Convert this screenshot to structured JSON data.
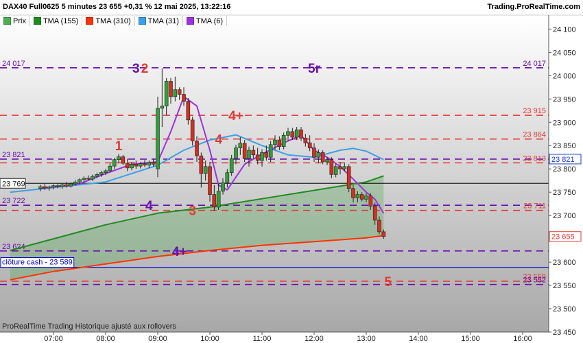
{
  "header": {
    "title": "DAX40 Full0625 5 minutes 23 655 +0,31 % 12 mai 2025, 13:22:16",
    "source": "Trading.ProRealTime.com",
    "footer": "ProRealTime Trading  Historique ajusté aux rollovers"
  },
  "legend": [
    {
      "label": "Prix",
      "color": "#4caf50"
    },
    {
      "label": "TMA (155)",
      "color": "#1e8c1e"
    },
    {
      "label": "TMA (310)",
      "color": "#ff3300"
    },
    {
      "label": "TMA (31)",
      "color": "#3da0e6"
    },
    {
      "label": "TMA (6)",
      "color": "#a030e0"
    }
  ],
  "chart_data": {
    "type": "candlestick",
    "instrument": "DAX40 Full0625",
    "timeframe": "5 minutes",
    "last_price": 23655,
    "change": "+0,31 %",
    "ylim": [
      23450,
      24130
    ],
    "y_ticks": [
      "24 100",
      "24 050",
      "24 000",
      "23 950",
      "23 900",
      "23 850",
      "23 800",
      "23 750",
      "23 700",
      "23 650",
      "23 600",
      "23 550",
      "23 500",
      "23 450"
    ],
    "x_ticks": [
      "07:00",
      "08:00",
      "09:00",
      "10:00",
      "11:00",
      "12:00",
      "13:00",
      "14:00",
      "15:00",
      "16:00"
    ],
    "x_ticks_time": [
      "07:00",
      "08:00",
      "09:00",
      "10:00",
      "11:00",
      "12:00",
      "13:00",
      "14:00",
      "15:00",
      "16:00"
    ],
    "candles": [
      {
        "t": "06:45",
        "o": 23758,
        "h": 23766,
        "l": 23752,
        "c": 23762
      },
      {
        "t": "06:50",
        "o": 23762,
        "h": 23768,
        "l": 23755,
        "c": 23759
      },
      {
        "t": "06:55",
        "o": 23759,
        "h": 23764,
        "l": 23753,
        "c": 23761
      },
      {
        "t": "07:00",
        "o": 23761,
        "h": 23767,
        "l": 23756,
        "c": 23764
      },
      {
        "t": "07:05",
        "o": 23764,
        "h": 23770,
        "l": 23758,
        "c": 23762
      },
      {
        "t": "07:10",
        "o": 23762,
        "h": 23769,
        "l": 23757,
        "c": 23766
      },
      {
        "t": "07:15",
        "o": 23766,
        "h": 23772,
        "l": 23760,
        "c": 23763
      },
      {
        "t": "07:20",
        "o": 23763,
        "h": 23771,
        "l": 23760,
        "c": 23768
      },
      {
        "t": "07:25",
        "o": 23768,
        "h": 23776,
        "l": 23764,
        "c": 23772
      },
      {
        "t": "07:30",
        "o": 23772,
        "h": 23780,
        "l": 23768,
        "c": 23777
      },
      {
        "t": "07:35",
        "o": 23777,
        "h": 23784,
        "l": 23772,
        "c": 23780
      },
      {
        "t": "07:40",
        "o": 23780,
        "h": 23786,
        "l": 23775,
        "c": 23778
      },
      {
        "t": "07:45",
        "o": 23778,
        "h": 23788,
        "l": 23774,
        "c": 23784
      },
      {
        "t": "07:50",
        "o": 23784,
        "h": 23792,
        "l": 23780,
        "c": 23788
      },
      {
        "t": "07:55",
        "o": 23788,
        "h": 23796,
        "l": 23783,
        "c": 23792
      },
      {
        "t": "08:00",
        "o": 23792,
        "h": 23800,
        "l": 23787,
        "c": 23796
      },
      {
        "t": "08:05",
        "o": 23796,
        "h": 23812,
        "l": 23792,
        "c": 23806
      },
      {
        "t": "08:10",
        "o": 23806,
        "h": 23824,
        "l": 23800,
        "c": 23820
      },
      {
        "t": "08:15",
        "o": 23820,
        "h": 23832,
        "l": 23812,
        "c": 23826
      },
      {
        "t": "08:20",
        "o": 23826,
        "h": 23830,
        "l": 23808,
        "c": 23812
      },
      {
        "t": "08:25",
        "o": 23812,
        "h": 23822,
        "l": 23795,
        "c": 23802
      },
      {
        "t": "08:30",
        "o": 23802,
        "h": 23815,
        "l": 23797,
        "c": 23810
      },
      {
        "t": "08:35",
        "o": 23810,
        "h": 23818,
        "l": 23800,
        "c": 23806
      },
      {
        "t": "08:40",
        "o": 23806,
        "h": 23814,
        "l": 23801,
        "c": 23811
      },
      {
        "t": "08:45",
        "o": 23811,
        "h": 23819,
        "l": 23804,
        "c": 23808
      },
      {
        "t": "08:50",
        "o": 23808,
        "h": 23818,
        "l": 23802,
        "c": 23814
      },
      {
        "t": "08:55",
        "o": 23814,
        "h": 23822,
        "l": 23805,
        "c": 23810
      },
      {
        "t": "09:00",
        "o": 23800,
        "h": 23955,
        "l": 23782,
        "c": 23930
      },
      {
        "t": "09:05",
        "o": 23930,
        "h": 24016,
        "l": 23890,
        "c": 23935
      },
      {
        "t": "09:10",
        "o": 23935,
        "h": 23995,
        "l": 23915,
        "c": 23988
      },
      {
        "t": "09:15",
        "o": 23988,
        "h": 23995,
        "l": 23940,
        "c": 23955
      },
      {
        "t": "09:20",
        "o": 23955,
        "h": 23998,
        "l": 23945,
        "c": 23970
      },
      {
        "t": "09:25",
        "o": 23970,
        "h": 23975,
        "l": 23948,
        "c": 23960
      },
      {
        "t": "09:30",
        "o": 23960,
        "h": 23975,
        "l": 23935,
        "c": 23945
      },
      {
        "t": "09:35",
        "o": 23945,
        "h": 23952,
        "l": 23895,
        "c": 23905
      },
      {
        "t": "09:40",
        "o": 23905,
        "h": 23912,
        "l": 23850,
        "c": 23860
      },
      {
        "t": "09:45",
        "o": 23860,
        "h": 23870,
        "l": 23815,
        "c": 23828
      },
      {
        "t": "09:50",
        "o": 23828,
        "h": 23835,
        "l": 23760,
        "c": 23790
      },
      {
        "t": "09:55",
        "o": 23790,
        "h": 23818,
        "l": 23775,
        "c": 23805
      },
      {
        "t": "10:00",
        "o": 23805,
        "h": 23815,
        "l": 23730,
        "c": 23745
      },
      {
        "t": "10:05",
        "o": 23745,
        "h": 23765,
        "l": 23710,
        "c": 23718
      },
      {
        "t": "10:10",
        "o": 23718,
        "h": 23768,
        "l": 23712,
        "c": 23752
      },
      {
        "t": "10:15",
        "o": 23752,
        "h": 23780,
        "l": 23745,
        "c": 23770
      },
      {
        "t": "10:20",
        "o": 23770,
        "h": 23800,
        "l": 23760,
        "c": 23792
      },
      {
        "t": "10:25",
        "o": 23792,
        "h": 23830,
        "l": 23785,
        "c": 23822
      },
      {
        "t": "10:30",
        "o": 23822,
        "h": 23852,
        "l": 23810,
        "c": 23845
      },
      {
        "t": "10:35",
        "o": 23845,
        "h": 23868,
        "l": 23830,
        "c": 23855
      },
      {
        "t": "10:40",
        "o": 23855,
        "h": 23862,
        "l": 23815,
        "c": 23822
      },
      {
        "t": "10:45",
        "o": 23822,
        "h": 23848,
        "l": 23805,
        "c": 23840
      },
      {
        "t": "10:50",
        "o": 23840,
        "h": 23850,
        "l": 23822,
        "c": 23830
      },
      {
        "t": "10:55",
        "o": 23830,
        "h": 23845,
        "l": 23810,
        "c": 23818
      },
      {
        "t": "11:00",
        "o": 23818,
        "h": 23842,
        "l": 23805,
        "c": 23835
      },
      {
        "t": "11:05",
        "o": 23835,
        "h": 23850,
        "l": 23818,
        "c": 23825
      },
      {
        "t": "11:10",
        "o": 23825,
        "h": 23860,
        "l": 23815,
        "c": 23852
      },
      {
        "t": "11:15",
        "o": 23852,
        "h": 23872,
        "l": 23840,
        "c": 23862
      },
      {
        "t": "11:20",
        "o": 23862,
        "h": 23870,
        "l": 23840,
        "c": 23848
      },
      {
        "t": "11:25",
        "o": 23848,
        "h": 23878,
        "l": 23842,
        "c": 23872
      },
      {
        "t": "11:30",
        "o": 23872,
        "h": 23888,
        "l": 23860,
        "c": 23880
      },
      {
        "t": "11:35",
        "o": 23880,
        "h": 23888,
        "l": 23862,
        "c": 23868
      },
      {
        "t": "11:40",
        "o": 23868,
        "h": 23890,
        "l": 23862,
        "c": 23884
      },
      {
        "t": "11:45",
        "o": 23884,
        "h": 23890,
        "l": 23860,
        "c": 23866
      },
      {
        "t": "11:50",
        "o": 23866,
        "h": 23875,
        "l": 23848,
        "c": 23856
      },
      {
        "t": "11:55",
        "o": 23856,
        "h": 23872,
        "l": 23838,
        "c": 23845
      },
      {
        "t": "12:00",
        "o": 23845,
        "h": 23855,
        "l": 23815,
        "c": 23825
      },
      {
        "t": "12:05",
        "o": 23825,
        "h": 23842,
        "l": 23812,
        "c": 23835
      },
      {
        "t": "12:10",
        "o": 23835,
        "h": 23840,
        "l": 23810,
        "c": 23815
      },
      {
        "t": "12:15",
        "o": 23815,
        "h": 23825,
        "l": 23808,
        "c": 23820
      },
      {
        "t": "12:20",
        "o": 23820,
        "h": 23825,
        "l": 23780,
        "c": 23788
      },
      {
        "t": "12:25",
        "o": 23788,
        "h": 23812,
        "l": 23782,
        "c": 23805
      },
      {
        "t": "12:30",
        "o": 23805,
        "h": 23815,
        "l": 23788,
        "c": 23800
      },
      {
        "t": "12:35",
        "o": 23800,
        "h": 23812,
        "l": 23795,
        "c": 23805
      },
      {
        "t": "12:40",
        "o": 23805,
        "h": 23810,
        "l": 23750,
        "c": 23758
      },
      {
        "t": "12:45",
        "o": 23758,
        "h": 23765,
        "l": 23728,
        "c": 23738
      },
      {
        "t": "12:50",
        "o": 23738,
        "h": 23752,
        "l": 23728,
        "c": 23745
      },
      {
        "t": "12:55",
        "o": 23745,
        "h": 23750,
        "l": 23730,
        "c": 23735
      },
      {
        "t": "13:00",
        "o": 23735,
        "h": 23748,
        "l": 23728,
        "c": 23742
      },
      {
        "t": "13:05",
        "o": 23742,
        "h": 23748,
        "l": 23712,
        "c": 23720
      },
      {
        "t": "13:10",
        "o": 23720,
        "h": 23728,
        "l": 23680,
        "c": 23690
      },
      {
        "t": "13:15",
        "o": 23690,
        "h": 23698,
        "l": 23660,
        "c": 23665
      },
      {
        "t": "13:20",
        "o": 23665,
        "h": 23670,
        "l": 23650,
        "c": 23655
      }
    ],
    "series": [
      {
        "name": "TMA (155)",
        "color": "#1e8c1e",
        "points": [
          [
            "06:10",
            23625
          ],
          [
            "07:00",
            23650
          ],
          [
            "08:00",
            23680
          ],
          [
            "09:00",
            23705
          ],
          [
            "10:00",
            23718
          ],
          [
            "11:00",
            23736
          ],
          [
            "12:00",
            23754
          ],
          [
            "13:00",
            23772
          ],
          [
            "13:20",
            23785
          ]
        ]
      },
      {
        "name": "TMA (310)",
        "color": "#ff3300",
        "points": [
          [
            "06:10",
            23562
          ],
          [
            "07:00",
            23580
          ],
          [
            "08:00",
            23596
          ],
          [
            "09:00",
            23612
          ],
          [
            "10:00",
            23625
          ],
          [
            "11:00",
            23636
          ],
          [
            "12:00",
            23644
          ],
          [
            "13:00",
            23652
          ],
          [
            "13:20",
            23657
          ]
        ]
      },
      {
        "name": "TMA (31)",
        "color": "#3da0e6",
        "points": [
          [
            "06:10",
            23750
          ],
          [
            "07:00",
            23760
          ],
          [
            "08:00",
            23772
          ],
          [
            "08:30",
            23790
          ],
          [
            "09:00",
            23808
          ],
          [
            "09:30",
            23840
          ],
          [
            "10:00",
            23862
          ],
          [
            "10:30",
            23873
          ],
          [
            "11:00",
            23850
          ],
          [
            "11:30",
            23830
          ],
          [
            "12:00",
            23825
          ],
          [
            "12:30",
            23840
          ],
          [
            "12:45",
            23844
          ],
          [
            "13:00",
            23838
          ],
          [
            "13:20",
            23820
          ]
        ]
      },
      {
        "name": "TMA (6)",
        "color": "#a030e0",
        "points": [
          [
            "06:45",
            23758
          ],
          [
            "07:30",
            23768
          ],
          [
            "08:00",
            23790
          ],
          [
            "08:30",
            23810
          ],
          [
            "09:00",
            23815
          ],
          [
            "09:15",
            23880
          ],
          [
            "09:30",
            23955
          ],
          [
            "09:45",
            23935
          ],
          [
            "10:00",
            23840
          ],
          [
            "10:10",
            23765
          ],
          [
            "10:20",
            23755
          ],
          [
            "10:40",
            23810
          ],
          [
            "11:00",
            23832
          ],
          [
            "11:30",
            23860
          ],
          [
            "11:45",
            23872
          ],
          [
            "12:00",
            23840
          ],
          [
            "12:15",
            23825
          ],
          [
            "12:30",
            23805
          ],
          [
            "12:45",
            23778
          ],
          [
            "13:00",
            23750
          ],
          [
            "13:10",
            23735
          ],
          [
            "13:20",
            23705
          ]
        ]
      }
    ],
    "levels": [
      {
        "value": 24017,
        "label_left": "24 017",
        "label_right": "24 017",
        "color": "#6a0dad",
        "dash": true
      },
      {
        "value": 23915,
        "label_left": "",
        "label_right": "23 915",
        "color": "#e53935",
        "dash": true
      },
      {
        "value": 23864,
        "label_left": "",
        "label_right": "23 864",
        "color": "#e53935",
        "dash": true
      },
      {
        "value": 23821,
        "label_left": "23 821",
        "label_right": "",
        "color": "#6a0dad",
        "dash": true
      },
      {
        "value": 23813,
        "label_left": "",
        "label_right": "23 813",
        "color": "#e53935",
        "dash": true
      },
      {
        "value": 23769,
        "label_left": "",
        "label_right": "",
        "color": "#222222",
        "dash": false
      },
      {
        "value": 23722,
        "label_left": "23 722",
        "label_right": "",
        "color": "#6a0dad",
        "dash": true
      },
      {
        "value": 23711,
        "label_left": "",
        "label_right": "23 711",
        "color": "#e53935",
        "dash": true
      },
      {
        "value": 23624,
        "label_left": "23 624",
        "label_right": "",
        "color": "#6a0dad",
        "dash": true
      },
      {
        "value": 23589,
        "label_left": "",
        "label_right": "",
        "color": "#0000cc",
        "dash": false
      },
      {
        "value": 23559,
        "label_left": "",
        "label_right": "23 559",
        "color": "#e53935",
        "dash": true
      },
      {
        "value": 23552,
        "label_left": "",
        "label_right": "23 552",
        "color": "#6a0dad",
        "dash": true
      }
    ],
    "price_boxes": [
      {
        "value": 23769,
        "label": "23 769",
        "side": "left",
        "color": "#222222"
      },
      {
        "value": 23821,
        "label": "23 821",
        "side": "right",
        "color": "#1a3fcc"
      },
      {
        "value": 23655,
        "label": "23 655",
        "side": "right",
        "color": "#e53935"
      }
    ],
    "close_label": {
      "text": "clôture cash  -  23 589",
      "value": 23589
    },
    "annotations": [
      {
        "text": "1",
        "time": "08:15",
        "value": 23850,
        "color": "#e53935"
      },
      {
        "text": "2",
        "time": "08:45",
        "value": 24017,
        "color": "#e53935"
      },
      {
        "text": "3",
        "time": "08:35",
        "value": 24017,
        "color": "#6a0dad"
      },
      {
        "text": "5r",
        "time": "12:00",
        "value": 24017,
        "color": "#6a0dad"
      },
      {
        "text": "4+",
        "time": "10:30",
        "value": 23915,
        "color": "#e53935"
      },
      {
        "text": "4",
        "time": "10:10",
        "value": 23864,
        "color": "#e53935"
      },
      {
        "text": "4",
        "time": "08:50",
        "value": 23722,
        "color": "#6a0dad"
      },
      {
        "text": "3",
        "time": "09:40",
        "value": 23711,
        "color": "#e53935"
      },
      {
        "text": "4+",
        "time": "09:25",
        "value": 23624,
        "color": "#6a0dad"
      },
      {
        "text": "5",
        "time": "13:25",
        "value": 23559,
        "color": "#e53935"
      }
    ]
  }
}
